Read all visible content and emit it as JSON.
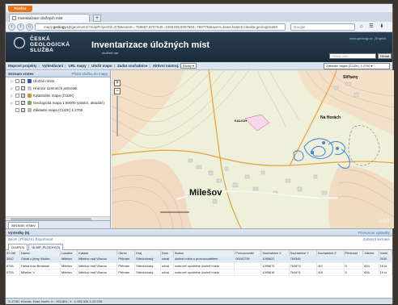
{
  "browser": {
    "app_button": "Firefox",
    "tab_title": "Inventarizace úložných míst",
    "new_tab": "+",
    "url_prefix": "mapy.",
    "url_domain": "geology.cz",
    "url_rest": "/geoinvent/?mapProjectId=378&extent=-768897,9707645;-1066336,8087804;-768775&layers=base,katastr,lokalita,geologicka50",
    "search_placeholder": "Google",
    "nav_icons": "⌂ ☰ ⬇"
  },
  "header": {
    "logo_line1": "ČESKÁ",
    "logo_line2": "GEOLOGICKÁ",
    "logo_line3": "SLUŽBA",
    "title": "Inventarizace úložných míst",
    "subtitle": "úložiště dat",
    "link": "www.geology.cz | English",
    "search_placeholder": "Hledat obec",
    "search_button": "Hledat"
  },
  "menu": {
    "items": [
      "Mapové projekty",
      "Vyhledávání",
      "URL mapy",
      "Uložit mapu",
      "Zadat souřadnice",
      "Aktivní nástroj:"
    ],
    "tool_select": "Žádný",
    "basemap_select": "Základní mapa (ČÚZK) 1:2700"
  },
  "layers_panel": {
    "title": "Seznam vrstev",
    "link": "Přidat službu do mapy",
    "layers": [
      {
        "label": "Úložné místo",
        "color": "#1d5fb8"
      },
      {
        "label": "Hranice územních jednotek",
        "color": "#c8c8c8"
      },
      {
        "label": "Katastrální mapa (ČÚZK)",
        "color": "#d48f3b"
      },
      {
        "label": "Geologická mapa 1:50000 (vlastní, aktuální)",
        "color": "#7ab04c"
      },
      {
        "label": "Základní mapa (ČÚZK) 1:2700",
        "color": "#b8b8b8"
      }
    ],
    "bottom_tab": "Seznam vrstev"
  },
  "map": {
    "labels": {
      "main": "Milešov",
      "kalich": "KALICH",
      "na_horach": "Na Horách",
      "strhany": "Střhany",
      "esri": "esri"
    },
    "zoom_in": "+",
    "zoom_out": "−"
  },
  "results": {
    "title": "Výsledky (5)",
    "link": "Přesunout výsledky",
    "actions": "Zoom | Přiblížit | Exportovat",
    "right_action": "Zobrazit seznam",
    "tabs": [
      "ÚLMP(5)",
      "ÚLMP_PLOCHY(3)"
    ],
    "columns": [
      "ID ÚM",
      "Název",
      "Lokalita",
      "Katastr",
      "Okres",
      "Kraj",
      "Druh",
      "Status",
      "Provozovatel",
      "Souřadnice X",
      "Souřadnice Y",
      "Souřadnice Z",
      "Přesnost",
      "Zákres",
      "Vznik"
    ],
    "rows": [
      [
        "3042",
        "Odval u jámy Václav",
        "Milešov",
        "Milešov nad Vltavou",
        "Příbram",
        "Středočeský",
        "odval",
        "úložné místo s provozovatelem",
        "00002739",
        "1095637",
        "764345",
        "",
        "",
        "",
        "2010"
      ],
      [
        "8746",
        "Halda dolu Bmanuel",
        "Milešov",
        "Milešov nad Vltavou",
        "Příbram",
        "Středočeský",
        "odval",
        "rozkrově opuštěné úložné místo",
        "",
        "1095675",
        "764573",
        "412",
        "5",
        "604",
        "16.st"
      ],
      [
        "5753",
        "Milešov V",
        "Milešov",
        "Milešov nad Vltavou",
        "Příbram",
        "Středočeský",
        "odval",
        "rozkrově opuštěné úložné místo",
        "",
        "1095616",
        "764474",
        "415",
        "5",
        "606",
        "19 st"
      ]
    ]
  },
  "status": {
    "text": "S-JTSK, Křovák, East, North:  X: -763 801, Y: -1 095 534  1:25 238"
  },
  "colors": {
    "header_bg": "#1f3346",
    "accent_link": "#3a78b8",
    "firefox_orange": "#e8731a"
  }
}
